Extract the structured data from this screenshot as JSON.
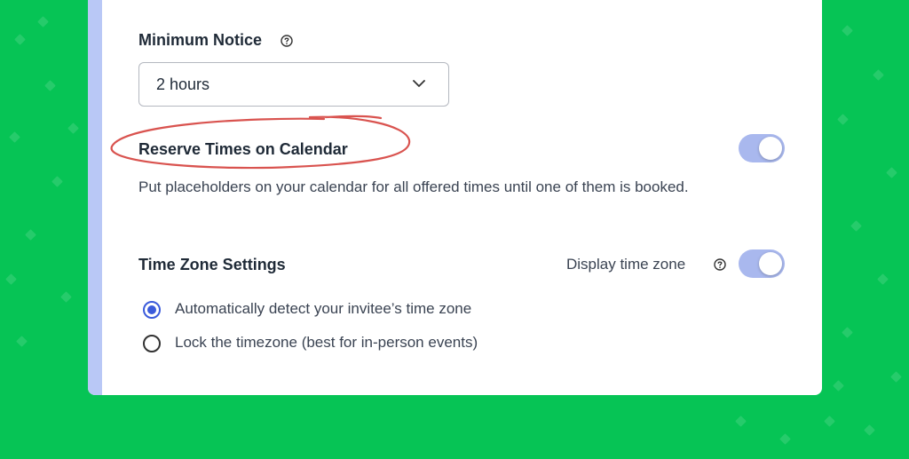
{
  "colors": {
    "background": "#06c455",
    "card": "#ffffff",
    "accent_bar": "#b9c8f6",
    "toggle_on": "#a9b8ee",
    "radio_selected": "#3b5bdb",
    "annotation_circle": "#d9534f"
  },
  "minimum_notice": {
    "label": "Minimum Notice",
    "help_icon": "help-circle-icon",
    "select": {
      "value": "2 hours",
      "icon": "chevron-down-icon"
    }
  },
  "reserve_times": {
    "label": "Reserve Times on Calendar",
    "toggle_on": true,
    "description": "Put placeholders on your calendar for all offered times until one of them is booked."
  },
  "time_zone": {
    "label": "Time Zone Settings",
    "display_label": "Display time zone",
    "help_icon": "help-circle-icon",
    "display_toggle_on": true,
    "options": [
      {
        "label": "Automatically detect your invitee’s time zone",
        "checked": true
      },
      {
        "label": "Lock the timezone (best for in-person events)",
        "checked": false
      }
    ]
  }
}
